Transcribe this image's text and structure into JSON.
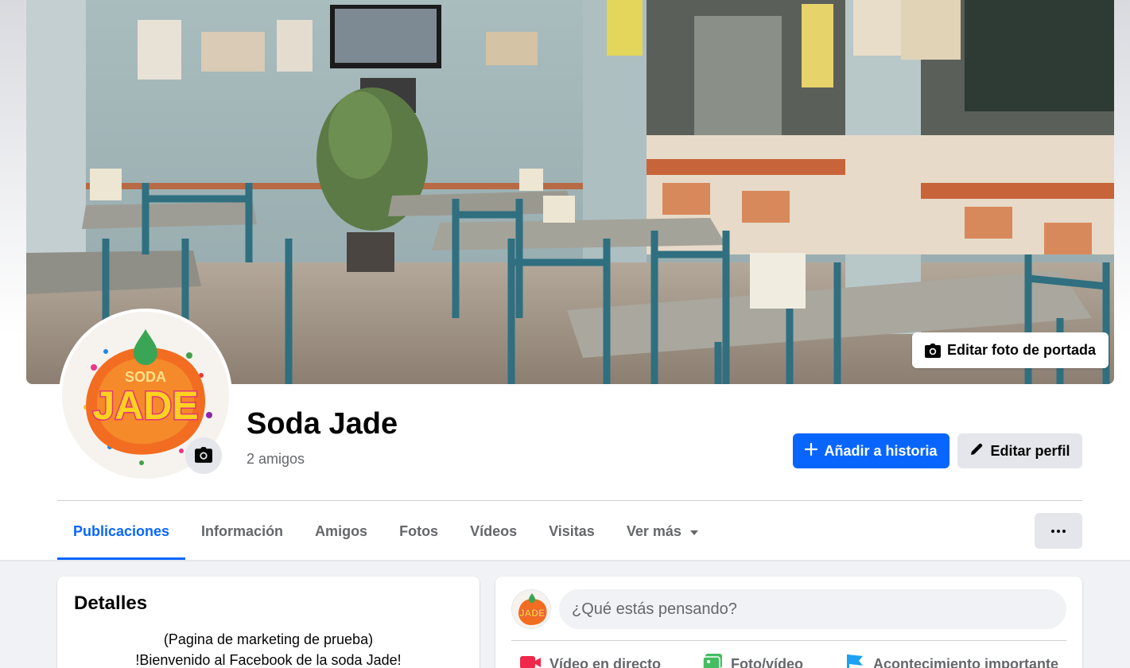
{
  "cover": {
    "edit_label": "Editar foto de portada"
  },
  "avatar": {
    "logo_small_text": "SODA",
    "logo_big_text": "JADE"
  },
  "profile": {
    "name": "Soda Jade",
    "friends": "2 amigos"
  },
  "actions": {
    "add_story": "Añadir a historia",
    "edit_profile": "Editar perfil"
  },
  "tabs": [
    {
      "label": "Publicaciones",
      "active": true
    },
    {
      "label": "Información"
    },
    {
      "label": "Amigos"
    },
    {
      "label": "Fotos"
    },
    {
      "label": "Vídeos"
    },
    {
      "label": "Visitas"
    },
    {
      "label": "Ver más"
    }
  ],
  "details": {
    "title": "Detalles",
    "bio_line1": "(Pagina de marketing de prueba)",
    "bio_line2": "!Bienvenido al Facebook de la soda Jade!"
  },
  "composer": {
    "placeholder": "¿Qué estás pensando?",
    "actions": [
      {
        "label": "Vídeo en directo",
        "icon": "live-video-icon",
        "color": "#f02849"
      },
      {
        "label": "Foto/vídeo",
        "icon": "photo-icon",
        "color": "#45bd62"
      },
      {
        "label": "Acontecimiento importante",
        "icon": "flag-icon",
        "color": "#1da1f2"
      }
    ]
  },
  "colors": {
    "accent": "#0866ff",
    "background": "#f0f2f5",
    "button_secondary": "#e4e6eb",
    "muted_text": "#65676b"
  }
}
